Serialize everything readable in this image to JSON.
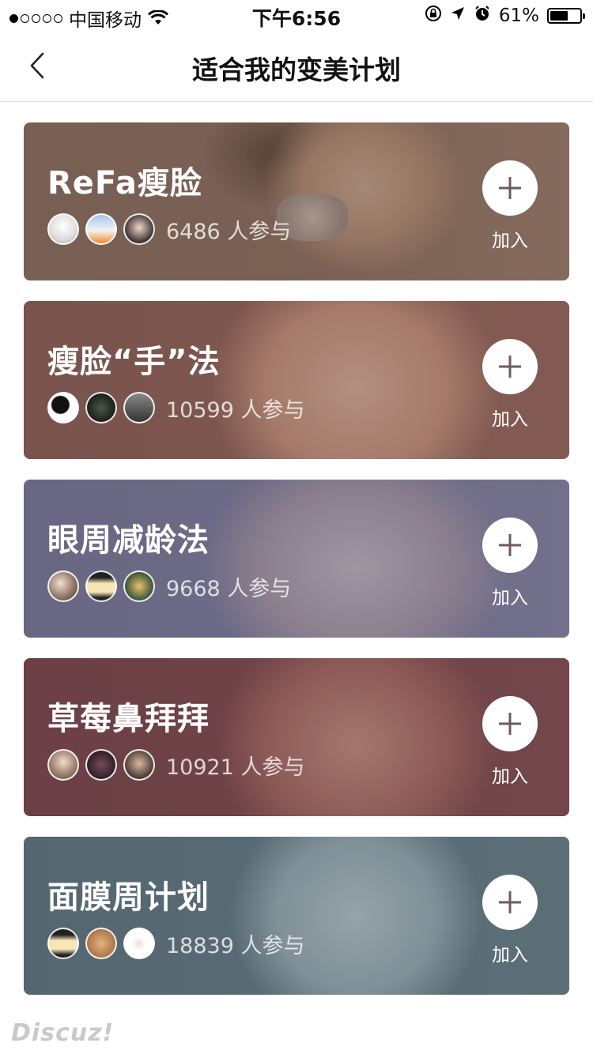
{
  "status_bar": {
    "carrier": "中国移动",
    "time": "下午6:56",
    "battery_percent": "61%",
    "battery_level": 0.61,
    "signal_dots_filled": 1,
    "signal_dots_total": 5
  },
  "nav": {
    "title": "适合我的变美计划",
    "back_icon": "chevron-left-icon"
  },
  "plans": [
    {
      "name": "ReFa瘦脸",
      "count": "6486",
      "suffix": "人参与",
      "join_label": "加入",
      "tint": "#7a6156"
    },
    {
      "name": "瘦脸“手”法",
      "count": "10599",
      "suffix": "人参与",
      "join_label": "加入",
      "tint": "#7d5650"
    },
    {
      "name": "眼周减龄法",
      "count": "9668",
      "suffix": "人参与",
      "join_label": "加入",
      "tint": "#6c6984"
    },
    {
      "name": "草莓鼻拜拜",
      "count": "10921",
      "suffix": "人参与",
      "join_label": "加入",
      "tint": "#6e4348"
    },
    {
      "name": "面膜周计划",
      "count": "18839",
      "suffix": "人参与",
      "join_label": "加入",
      "tint": "#586a73"
    }
  ],
  "watermark": "Discuz!",
  "colors": {
    "plus_icon": "#6f5b5e",
    "text_primary": "#111111"
  }
}
